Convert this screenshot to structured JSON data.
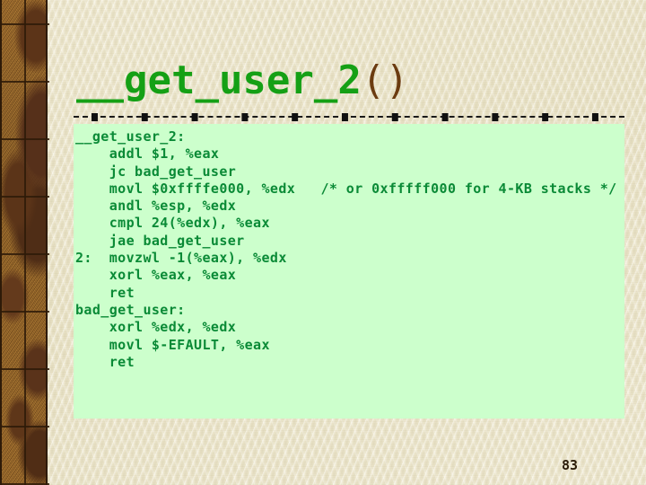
{
  "slide": {
    "title_text": "__get_user_2",
    "title_paren": "()",
    "page_number": "83",
    "colors": {
      "page_background": "#ebe5cb",
      "code_background": "#ccffcc",
      "title_green": "#15a015",
      "title_paren_brown": "#6b3b10",
      "code_green": "#0a8a36",
      "separator_black": "#1a1a1a",
      "border_brown_light": "#a8752c",
      "border_brown_dark": "#4f2d16",
      "border_outline": "#2d1a08",
      "page_number_color": "#2b1c08"
    }
  },
  "code": {
    "language": "x86-assembly",
    "lines": [
      "__get_user_2:",
      "    addl $1, %eax",
      "    jc bad_get_user",
      "    movl $0xffffe000, %edx   /* or 0xfffff000 for 4-KB stacks */",
      "    andl %esp, %edx",
      "    cmpl 24(%edx), %eax",
      "    jae bad_get_user",
      "2:  movzwl -1(%eax), %edx",
      "    xorl %eax, %eax",
      "    ret",
      "bad_get_user:",
      "    xorl %edx, %edx",
      "    movl $-EFAULT, %eax",
      "    ret"
    ],
    "text": "__get_user_2:\n    addl $1, %eax\n    jc bad_get_user\n    movl $0xffffe000, %edx   /* or 0xfffff000 for 4-KB stacks */\n    andl %esp, %edx\n    cmpl 24(%edx), %eax\n    jae bad_get_user\n2:  movzwl -1(%eax), %edx\n    xorl %eax, %eax\n    ret\nbad_get_user:\n    xorl %edx, %edx\n    movl $-EFAULT, %eax\n    ret"
  }
}
